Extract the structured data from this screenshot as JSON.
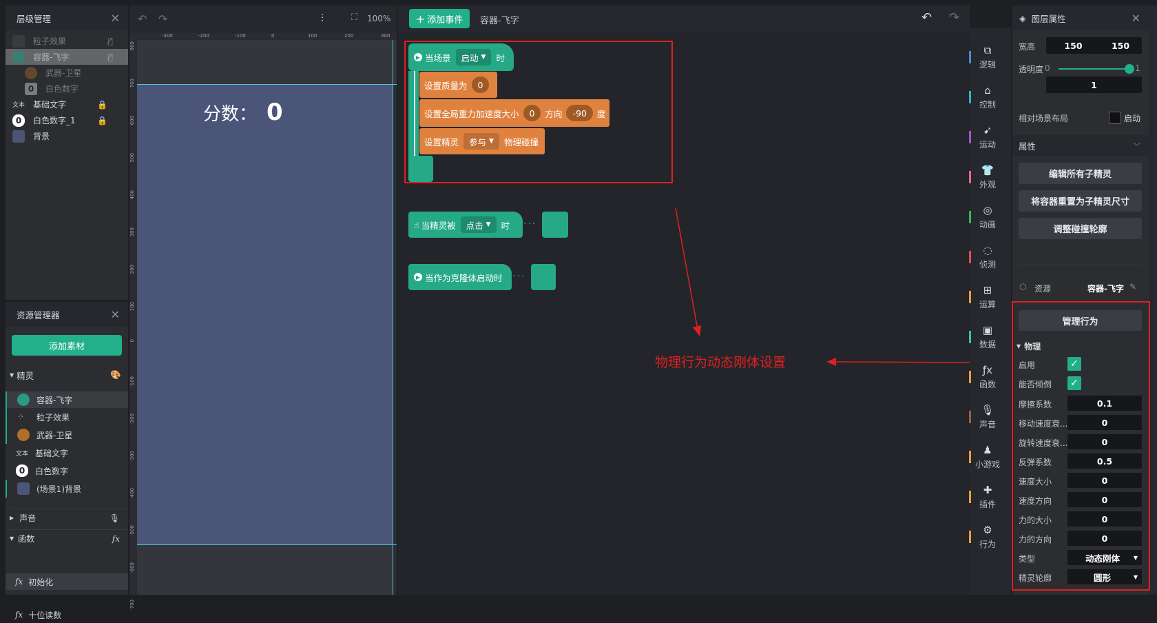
{
  "layers_panel": {
    "title": "层级管理",
    "items": [
      {
        "label": "粒子效果",
        "faded": true
      },
      {
        "label": "容器-飞字",
        "faded": true,
        "selected": true
      },
      {
        "label": "武器-卫星",
        "faded": true,
        "indent": true
      },
      {
        "label": "白色数字",
        "faded": true,
        "indent": true
      },
      {
        "label": "基础文字",
        "icon_text": "文本"
      },
      {
        "label": "白色数字_1"
      },
      {
        "label": "背景"
      }
    ]
  },
  "canvas_toolbar": {
    "zoom": "100%"
  },
  "ruler": {
    "h_ticks": [
      "-300",
      "-200",
      "-100",
      "0",
      "100",
      "200",
      "300"
    ],
    "v_ticks": [
      "800",
      "700",
      "600",
      "500",
      "400",
      "300",
      "200",
      "100",
      "0",
      "-100",
      "-200",
      "-300",
      "-400",
      "-500",
      "-600",
      "-700"
    ]
  },
  "stage": {
    "score_label": "分数：",
    "score_value": "0"
  },
  "assets_panel": {
    "title": "资源管理器",
    "add_button": "添加素材",
    "sprites_section": "精灵",
    "sprites": [
      {
        "label": "容器-飞字"
      },
      {
        "label": "粒子效果"
      },
      {
        "label": "武器-卫星"
      },
      {
        "label": "基础文字",
        "icon_text": "文本"
      },
      {
        "label": "白色数字"
      },
      {
        "label": "(场景1)背景"
      }
    ],
    "sound_section": "声音",
    "functions_section": "函数",
    "functions": [
      {
        "label": "初始化"
      },
      {
        "label": "十位读数"
      }
    ],
    "fx_symbol": "fx"
  },
  "editor": {
    "add_event_button": "添加事件",
    "sprite_name": "容器-飞字",
    "blocks": {
      "scene_start": {
        "prefix": "当场景",
        "dropdown": "启动",
        "suffix": "时"
      },
      "set_mass": {
        "label": "设置质量为",
        "value": "0"
      },
      "set_gravity": {
        "label": "设置全局重力加速度大小",
        "value": "0",
        "dir_label": "方向",
        "dir_value": "-90",
        "unit": "度"
      },
      "set_sprite": {
        "label": "设置精灵",
        "dropdown": "参与",
        "suffix": "物理碰撞"
      },
      "sprite_clicked": {
        "prefix": "当精灵被",
        "dropdown": "点击",
        "suffix": "时"
      },
      "clone_start": {
        "label": "当作为克隆体启动时"
      }
    },
    "annotation": "物理行为动态刚体设置"
  },
  "categories": [
    {
      "label": "逻辑",
      "icon": "logic-icon",
      "color": "#4a8ad8"
    },
    {
      "label": "控制",
      "icon": "control-icon",
      "color": "#3ab0c8"
    },
    {
      "label": "运动",
      "icon": "motion-icon",
      "color": "#9a5ad8"
    },
    {
      "label": "外观",
      "icon": "looks-icon",
      "color": "#e06a8a"
    },
    {
      "label": "动画",
      "icon": "animation-icon",
      "color": "#34b85a"
    },
    {
      "label": "侦测",
      "icon": "sensing-icon",
      "color": "#e05050"
    },
    {
      "label": "运算",
      "icon": "operator-icon",
      "color": "#e0a040"
    },
    {
      "label": "数据",
      "icon": "data-icon",
      "color": "#40c0a0"
    },
    {
      "label": "函数",
      "icon": "function-icon",
      "color": "#e0a040"
    },
    {
      "label": "声音",
      "icon": "sound-icon",
      "color": "#9a6040"
    },
    {
      "label": "小游戏",
      "icon": "minigame-icon",
      "color": "#e0a040"
    },
    {
      "label": "插件",
      "icon": "plugin-icon",
      "color": "#e0a040"
    },
    {
      "label": "行为",
      "icon": "behavior-icon",
      "color": "#e0a040"
    }
  ],
  "properties_panel": {
    "title": "图层属性",
    "size_label": "宽高",
    "width": "150",
    "height": "150",
    "opacity_label": "透明度",
    "opacity_min": "0",
    "opacity_max": "1",
    "opacity_value": "1",
    "opacity_level": 1.0,
    "relative_layout_label": "相对场景布局",
    "relative_layout_toggle": "启动",
    "attributes_section": "属性",
    "edit_children_button": "编辑所有子精灵",
    "reset_size_button": "将容器重置为子精灵尺寸",
    "adjust_collision_button": "调整碰撞轮廓",
    "resource_label": "资源",
    "resource_value": "容器-飞字",
    "manage_behavior_button": "管理行为",
    "physics_section": "物理",
    "physics": {
      "enable_label": "启用",
      "can_tilt_label": "能否倾倒",
      "friction_label": "摩擦系数",
      "friction": "0.1",
      "linear_damping_label": "移动速度衰...",
      "linear_damping": "0",
      "angular_damping_label": "旋转速度衰...",
      "angular_damping": "0",
      "restitution_label": "反弹系数",
      "restitution": "0.5",
      "speed_label": "速度大小",
      "speed": "0",
      "speed_dir_label": "速度方向",
      "speed_dir": "0",
      "force_label": "力的大小",
      "force": "0",
      "force_dir_label": "力的方向",
      "force_dir": "0",
      "type_label": "类型",
      "type": "动态刚体",
      "shape_label": "精灵轮廓",
      "shape": "圆形"
    }
  }
}
